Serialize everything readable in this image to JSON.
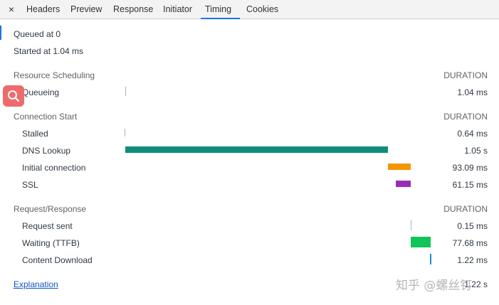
{
  "tabs": {
    "close_symbol": "×",
    "items": [
      "Headers",
      "Preview",
      "Response",
      "Initiator",
      "Timing",
      "Cookies"
    ],
    "active": "Timing"
  },
  "summary": {
    "queued": "Queued at 0",
    "started": "Started at 1.04 ms"
  },
  "duration_header": "DURATION",
  "sections": {
    "resource_scheduling": {
      "title": "Resource Scheduling",
      "rows": [
        {
          "label": "Queueing",
          "value": "1.04 ms"
        }
      ]
    },
    "connection_start": {
      "title": "Connection Start",
      "rows": [
        {
          "label": "Stalled",
          "value": "0.64 ms"
        },
        {
          "label": "DNS Lookup",
          "value": "1.05 s"
        },
        {
          "label": "Initial connection",
          "value": "93.09 ms"
        },
        {
          "label": "SSL",
          "value": "61.15 ms"
        }
      ]
    },
    "request_response": {
      "title": "Request/Response",
      "rows": [
        {
          "label": "Request sent",
          "value": "0.15 ms"
        },
        {
          "label": "Waiting (TTFB)",
          "value": "77.68 ms"
        },
        {
          "label": "Content Download",
          "value": "1.22 ms"
        }
      ]
    }
  },
  "colors": {
    "dns": "#0e8d7a",
    "initial_connection": "#f29600",
    "ssl": "#9a2eb3",
    "waiting": "#10c459",
    "content_download": "#1a8fe0",
    "search_button": "#ef6b6b"
  },
  "footer": {
    "explanation_link": "Explanation",
    "total": "1.22 s"
  },
  "watermark": "知乎 @螺丝钉",
  "icons": {
    "close": "close-icon",
    "search": "search-icon"
  }
}
